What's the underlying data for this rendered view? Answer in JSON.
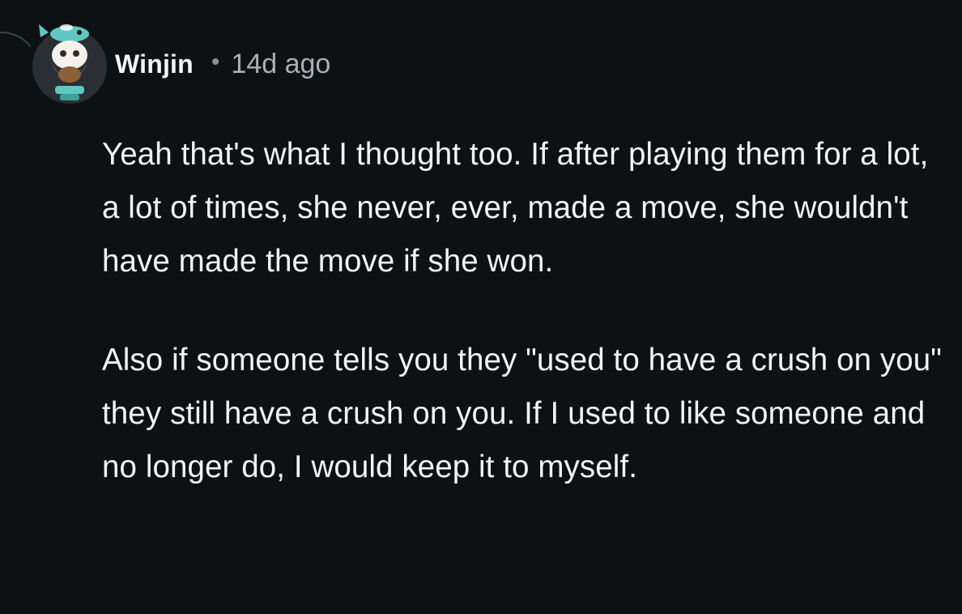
{
  "comment": {
    "author": "Winjin",
    "separator": "•",
    "timestamp": "14d ago",
    "avatar_icon": "snoo-avatar-icon",
    "paragraphs": [
      "Yeah that's what I thought too. If after playing them for a lot, a lot of times, she never, ever, made a move, she wouldn't have made the move if she won.",
      "Also if someone tells you they \"used to have a crush on you\" they still have a crush on you. If I used to like someone and no longer do, I would keep it to myself."
    ]
  },
  "colors": {
    "background": "#0e1113",
    "text": "#f2f4f5",
    "meta_text": "#a8b0b5",
    "thread_line": "#3a4146"
  }
}
